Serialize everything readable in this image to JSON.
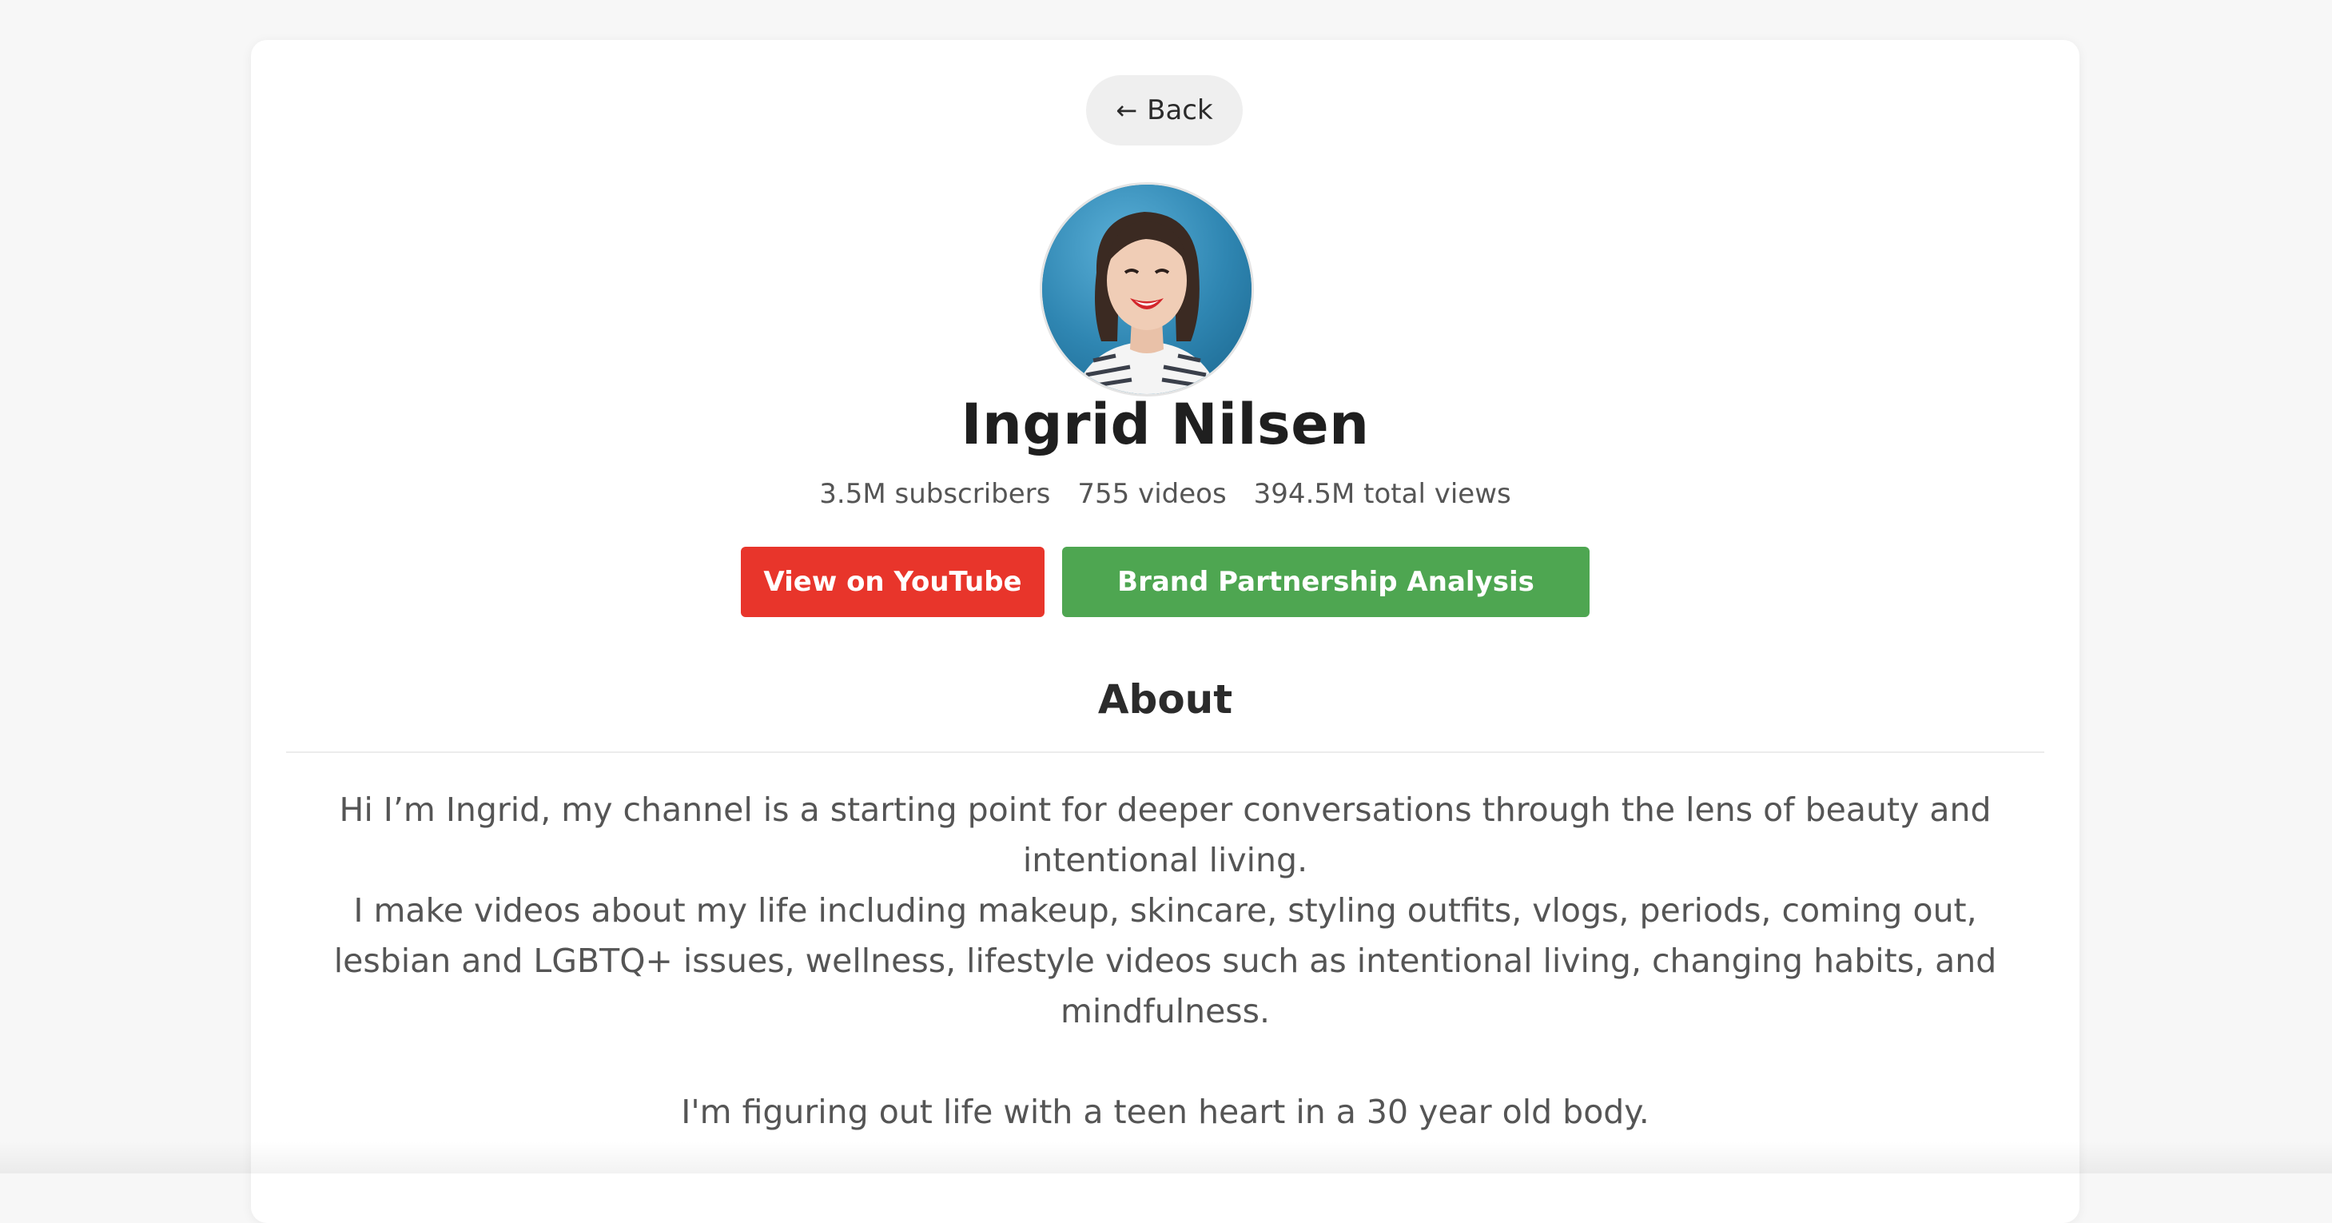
{
  "back": {
    "label": "Back",
    "icon": "arrow-left-icon"
  },
  "profile": {
    "name": "Ingrid Nilsen",
    "avatar": "profile-photo",
    "stats": {
      "subscribers": "3.5M subscribers",
      "videos": "755 videos",
      "views": "394.5M total views"
    }
  },
  "actions": {
    "youtube_label": "View on YouTube",
    "brand_label": "Brand Partnership Analysis"
  },
  "about": {
    "title": "About",
    "paragraph_1": "Hi I’m Ingrid, my channel is a starting point for deeper conversations through the lens of beauty and intentional living.",
    "paragraph_2": "I make videos about my life including makeup, skincare, styling outfits, vlogs, periods, coming out, lesbian and LGBTQ+ issues, wellness, lifestyle videos such as intentional living, changing habits, and mindfulness.",
    "paragraph_3": "I'm figuring out life with a teen heart in a 30 year old body."
  },
  "colors": {
    "youtube": "#e8352b",
    "brand": "#4ea651",
    "background": "#f7f7f7",
    "card": "#ffffff"
  }
}
